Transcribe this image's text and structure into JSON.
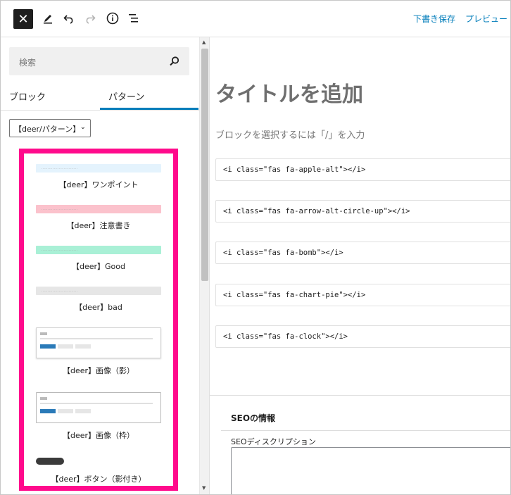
{
  "toolbar": {
    "save_draft": "下書き保存",
    "preview": "プレビュー"
  },
  "sidebar": {
    "search_placeholder": "検索",
    "tabs": [
      {
        "label": "ブロック"
      },
      {
        "label": "パターン"
      }
    ],
    "category_select": "【deer/パターン】",
    "patterns": [
      {
        "label": "【deer】ワンポイント",
        "preview_color": "#e4f3fd"
      },
      {
        "label": "【deer】注意書き",
        "preview_color": "#fbc2cc"
      },
      {
        "label": "【deer】Good",
        "preview_color": "#a9f0d6"
      },
      {
        "label": "【deer】bad",
        "preview_color": "#e6e6e6"
      },
      {
        "label": "【deer】画像（影）"
      },
      {
        "label": "【deer】画像（枠）"
      },
      {
        "label": "【deer】ボタン（影付き）"
      }
    ]
  },
  "editor": {
    "title_placeholder": "タイトルを追加",
    "block_hint": "ブロックを選択するには「/」を入力",
    "code_blocks": [
      "<i class=\"fas fa-apple-alt\"></i>",
      "<i class=\"fas fa-arrow-alt-circle-up\"></i>",
      "<i class=\"fas fa-bomb\"></i>",
      "<i class=\"fas fa-chart-pie\"></i>",
      "<i class=\"fas fa-clock\"></i>"
    ]
  },
  "seo": {
    "title": "SEOの情報",
    "description_label": "SEOディスクリプション"
  },
  "colors": {
    "accent": "#007cba",
    "highlight": "#ff0a8c"
  }
}
